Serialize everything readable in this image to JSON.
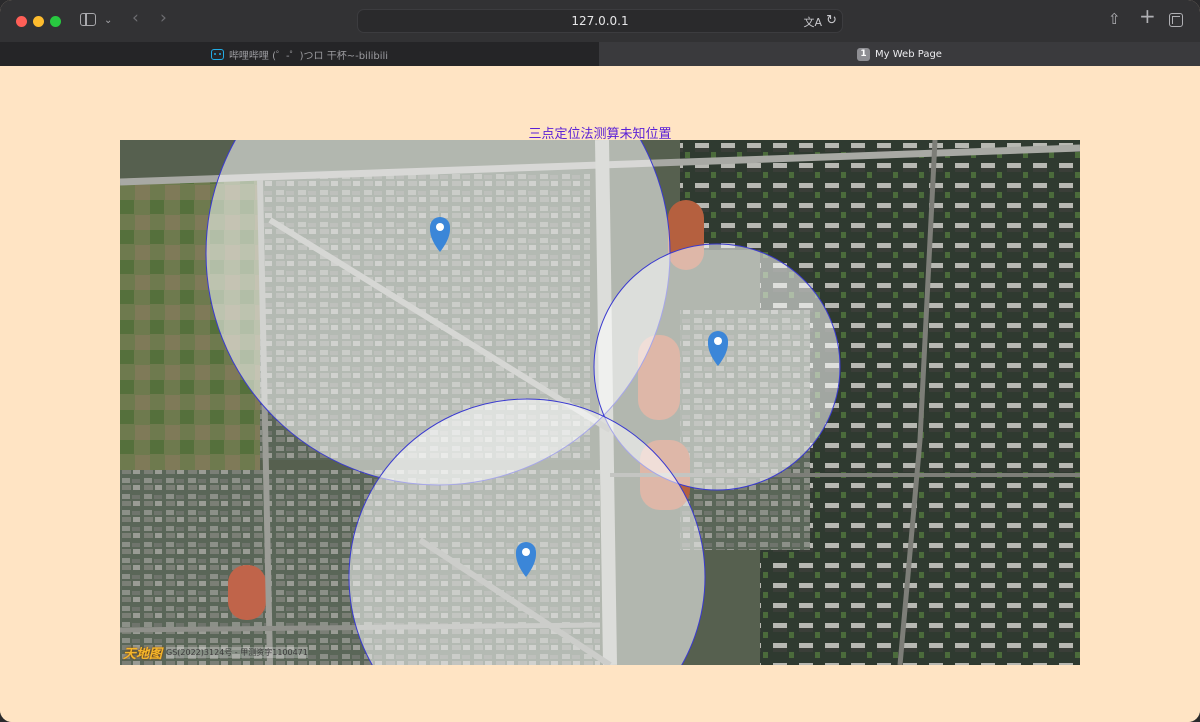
{
  "browser": {
    "address": "127.0.0.1",
    "tabs": [
      {
        "label": "哔哩哔哩 (゜-゜)つロ 干杯~-bilibili",
        "active": false
      },
      {
        "badge": "1",
        "label": "My Web Page",
        "active": true
      }
    ]
  },
  "page": {
    "title": "三点定位法测算未知位置"
  },
  "map": {
    "type": "satellite",
    "watermark_logo": "天地图",
    "watermark_text": "GS(2022)3124号 - 甲测资字1100471",
    "circle_fill": "#ffffff",
    "circle_stroke": "#3a3ad0",
    "marker_color": "#3b86d8",
    "markers": [
      {
        "name": "marker-1"
      },
      {
        "name": "marker-2"
      },
      {
        "name": "marker-3"
      }
    ]
  }
}
